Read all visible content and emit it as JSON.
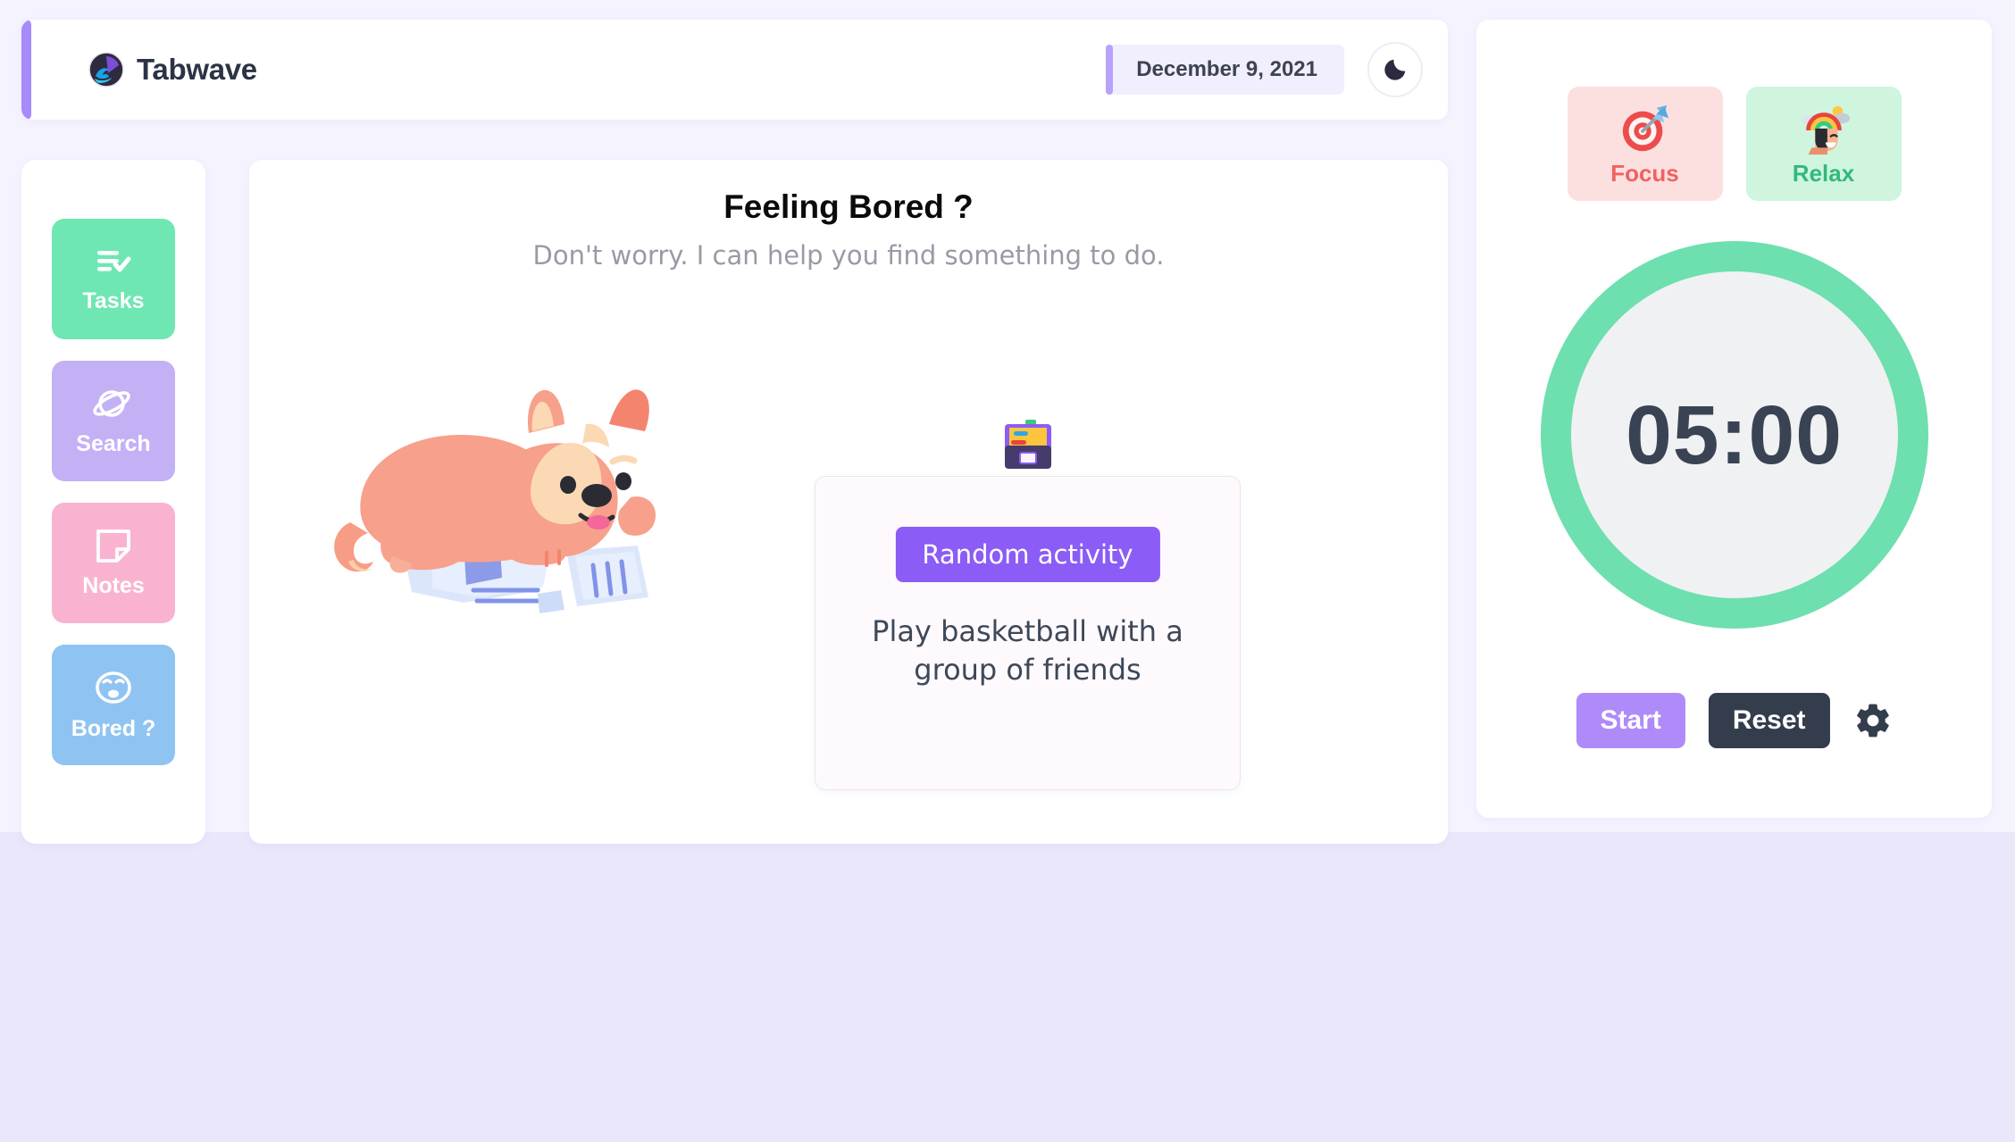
{
  "header": {
    "brand_name": "Tabwave",
    "logo_icon": "wave-logo-icon",
    "date": "December 9, 2021",
    "theme_toggle_icon": "moon-icon",
    "accent_color": "#A78BFA"
  },
  "sidebar": {
    "items": [
      {
        "label": "Tasks",
        "icon": "checklist-icon",
        "color": "#6EE7B2"
      },
      {
        "label": "Search",
        "icon": "planet-icon",
        "color": "#C3B0F5"
      },
      {
        "label": "Notes",
        "icon": "sticky-note-icon",
        "color": "#F9B3D1"
      },
      {
        "label": "Bored ?",
        "icon": "tired-face-icon",
        "color": "#8FC4F2"
      }
    ]
  },
  "main": {
    "title": "Feeling Bored ?",
    "subtitle": "Don't worry. I can help you find something to do.",
    "illustration_icon": "bored-dog-with-torn-papers-illustration",
    "activity": {
      "emoji_icon": "card-index-box-icon",
      "button_label": "Random activity",
      "button_color": "#8B5CF6",
      "text": "Play basketball with a group of friends"
    }
  },
  "timer_panel": {
    "modes": [
      {
        "label": "Focus",
        "icon": "dart-target-icon",
        "bg": "#FCE0E0",
        "text_color": "#F0625E"
      },
      {
        "label": "Relax",
        "icon": "head-rainbow-icon",
        "bg": "#CFF5DF",
        "text_color": "#33B97C"
      }
    ],
    "time_display": "05:00",
    "ring_color": "#6EDFAE",
    "controls": {
      "start_label": "Start",
      "reset_label": "Reset",
      "settings_icon": "gear-icon",
      "start_color": "#AE8BF9",
      "reset_color": "#343D4C"
    }
  }
}
